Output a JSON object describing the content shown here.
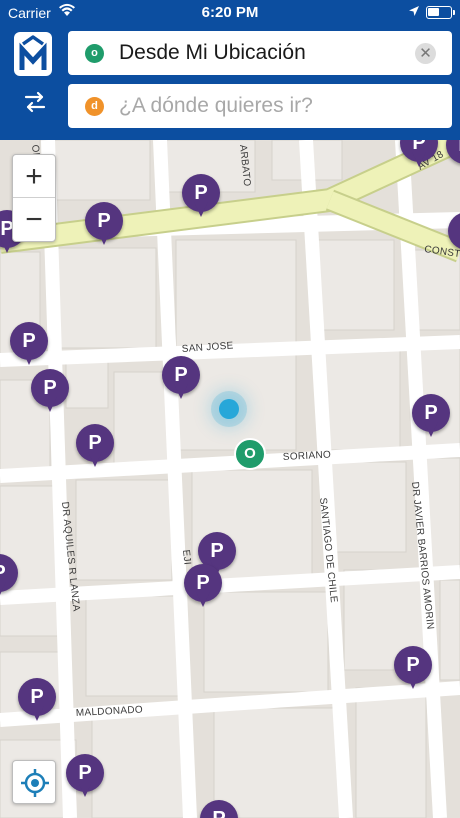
{
  "status": {
    "carrier": "Carrier",
    "time": "6:20 PM"
  },
  "colors": {
    "brand": "#0c4ea0",
    "pin": "#55357f",
    "origin": "#1f9c6b",
    "destination": "#f0922a",
    "user_location": "#27a7d9"
  },
  "search": {
    "origin_badge": "o",
    "origin_value": "Desde Mi Ubicación",
    "destination_badge": "d",
    "destination_placeholder": "¿A dónde quieres ir?"
  },
  "map": {
    "zoom_in": "+",
    "zoom_out": "−",
    "origin_marker": "O",
    "parking_letter": "P",
    "streets": [
      "AV 18",
      "CONSTI",
      "ARBATO",
      "ORO",
      "SAN JOSE",
      "SORIANO",
      "DR AQUILES R LANZA",
      "SANTIAGO DE CHILE",
      "DR JAVIER BARRIOS AMORIN",
      "MALDONADO",
      "EJI"
    ]
  },
  "icons": [
    "app-logo-icon",
    "swap-icon",
    "clear-icon",
    "locate-icon",
    "wifi-icon",
    "location-arrow-icon",
    "battery-icon"
  ]
}
